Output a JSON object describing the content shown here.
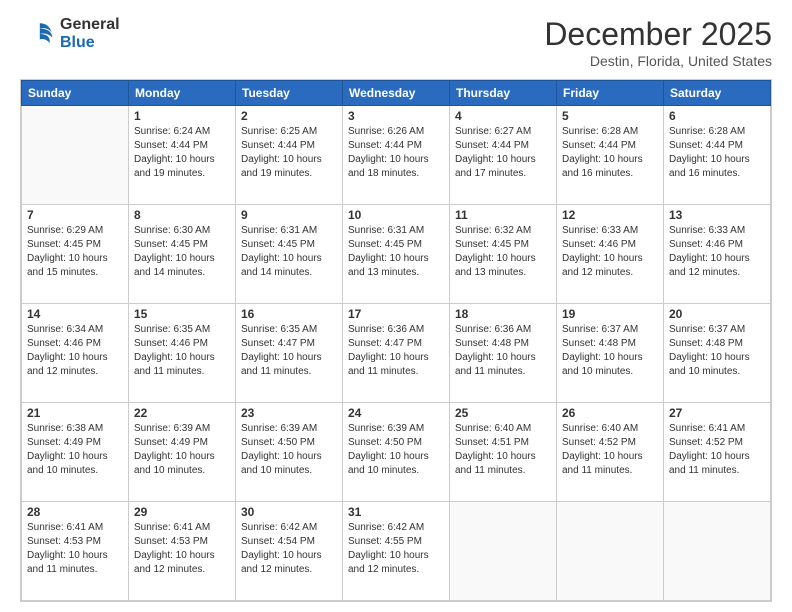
{
  "header": {
    "logo_line1": "General",
    "logo_line2": "Blue",
    "month": "December 2025",
    "location": "Destin, Florida, United States"
  },
  "days_of_week": [
    "Sunday",
    "Monday",
    "Tuesday",
    "Wednesday",
    "Thursday",
    "Friday",
    "Saturday"
  ],
  "weeks": [
    [
      {
        "day": "",
        "info": ""
      },
      {
        "day": "1",
        "info": "Sunrise: 6:24 AM\nSunset: 4:44 PM\nDaylight: 10 hours\nand 19 minutes."
      },
      {
        "day": "2",
        "info": "Sunrise: 6:25 AM\nSunset: 4:44 PM\nDaylight: 10 hours\nand 19 minutes."
      },
      {
        "day": "3",
        "info": "Sunrise: 6:26 AM\nSunset: 4:44 PM\nDaylight: 10 hours\nand 18 minutes."
      },
      {
        "day": "4",
        "info": "Sunrise: 6:27 AM\nSunset: 4:44 PM\nDaylight: 10 hours\nand 17 minutes."
      },
      {
        "day": "5",
        "info": "Sunrise: 6:28 AM\nSunset: 4:44 PM\nDaylight: 10 hours\nand 16 minutes."
      },
      {
        "day": "6",
        "info": "Sunrise: 6:28 AM\nSunset: 4:44 PM\nDaylight: 10 hours\nand 16 minutes."
      }
    ],
    [
      {
        "day": "7",
        "info": "Sunrise: 6:29 AM\nSunset: 4:45 PM\nDaylight: 10 hours\nand 15 minutes."
      },
      {
        "day": "8",
        "info": "Sunrise: 6:30 AM\nSunset: 4:45 PM\nDaylight: 10 hours\nand 14 minutes."
      },
      {
        "day": "9",
        "info": "Sunrise: 6:31 AM\nSunset: 4:45 PM\nDaylight: 10 hours\nand 14 minutes."
      },
      {
        "day": "10",
        "info": "Sunrise: 6:31 AM\nSunset: 4:45 PM\nDaylight: 10 hours\nand 13 minutes."
      },
      {
        "day": "11",
        "info": "Sunrise: 6:32 AM\nSunset: 4:45 PM\nDaylight: 10 hours\nand 13 minutes."
      },
      {
        "day": "12",
        "info": "Sunrise: 6:33 AM\nSunset: 4:46 PM\nDaylight: 10 hours\nand 12 minutes."
      },
      {
        "day": "13",
        "info": "Sunrise: 6:33 AM\nSunset: 4:46 PM\nDaylight: 10 hours\nand 12 minutes."
      }
    ],
    [
      {
        "day": "14",
        "info": "Sunrise: 6:34 AM\nSunset: 4:46 PM\nDaylight: 10 hours\nand 12 minutes."
      },
      {
        "day": "15",
        "info": "Sunrise: 6:35 AM\nSunset: 4:46 PM\nDaylight: 10 hours\nand 11 minutes."
      },
      {
        "day": "16",
        "info": "Sunrise: 6:35 AM\nSunset: 4:47 PM\nDaylight: 10 hours\nand 11 minutes."
      },
      {
        "day": "17",
        "info": "Sunrise: 6:36 AM\nSunset: 4:47 PM\nDaylight: 10 hours\nand 11 minutes."
      },
      {
        "day": "18",
        "info": "Sunrise: 6:36 AM\nSunset: 4:48 PM\nDaylight: 10 hours\nand 11 minutes."
      },
      {
        "day": "19",
        "info": "Sunrise: 6:37 AM\nSunset: 4:48 PM\nDaylight: 10 hours\nand 10 minutes."
      },
      {
        "day": "20",
        "info": "Sunrise: 6:37 AM\nSunset: 4:48 PM\nDaylight: 10 hours\nand 10 minutes."
      }
    ],
    [
      {
        "day": "21",
        "info": "Sunrise: 6:38 AM\nSunset: 4:49 PM\nDaylight: 10 hours\nand 10 minutes."
      },
      {
        "day": "22",
        "info": "Sunrise: 6:39 AM\nSunset: 4:49 PM\nDaylight: 10 hours\nand 10 minutes."
      },
      {
        "day": "23",
        "info": "Sunrise: 6:39 AM\nSunset: 4:50 PM\nDaylight: 10 hours\nand 10 minutes."
      },
      {
        "day": "24",
        "info": "Sunrise: 6:39 AM\nSunset: 4:50 PM\nDaylight: 10 hours\nand 10 minutes."
      },
      {
        "day": "25",
        "info": "Sunrise: 6:40 AM\nSunset: 4:51 PM\nDaylight: 10 hours\nand 11 minutes."
      },
      {
        "day": "26",
        "info": "Sunrise: 6:40 AM\nSunset: 4:52 PM\nDaylight: 10 hours\nand 11 minutes."
      },
      {
        "day": "27",
        "info": "Sunrise: 6:41 AM\nSunset: 4:52 PM\nDaylight: 10 hours\nand 11 minutes."
      }
    ],
    [
      {
        "day": "28",
        "info": "Sunrise: 6:41 AM\nSunset: 4:53 PM\nDaylight: 10 hours\nand 11 minutes."
      },
      {
        "day": "29",
        "info": "Sunrise: 6:41 AM\nSunset: 4:53 PM\nDaylight: 10 hours\nand 12 minutes."
      },
      {
        "day": "30",
        "info": "Sunrise: 6:42 AM\nSunset: 4:54 PM\nDaylight: 10 hours\nand 12 minutes."
      },
      {
        "day": "31",
        "info": "Sunrise: 6:42 AM\nSunset: 4:55 PM\nDaylight: 10 hours\nand 12 minutes."
      },
      {
        "day": "",
        "info": ""
      },
      {
        "day": "",
        "info": ""
      },
      {
        "day": "",
        "info": ""
      }
    ]
  ]
}
